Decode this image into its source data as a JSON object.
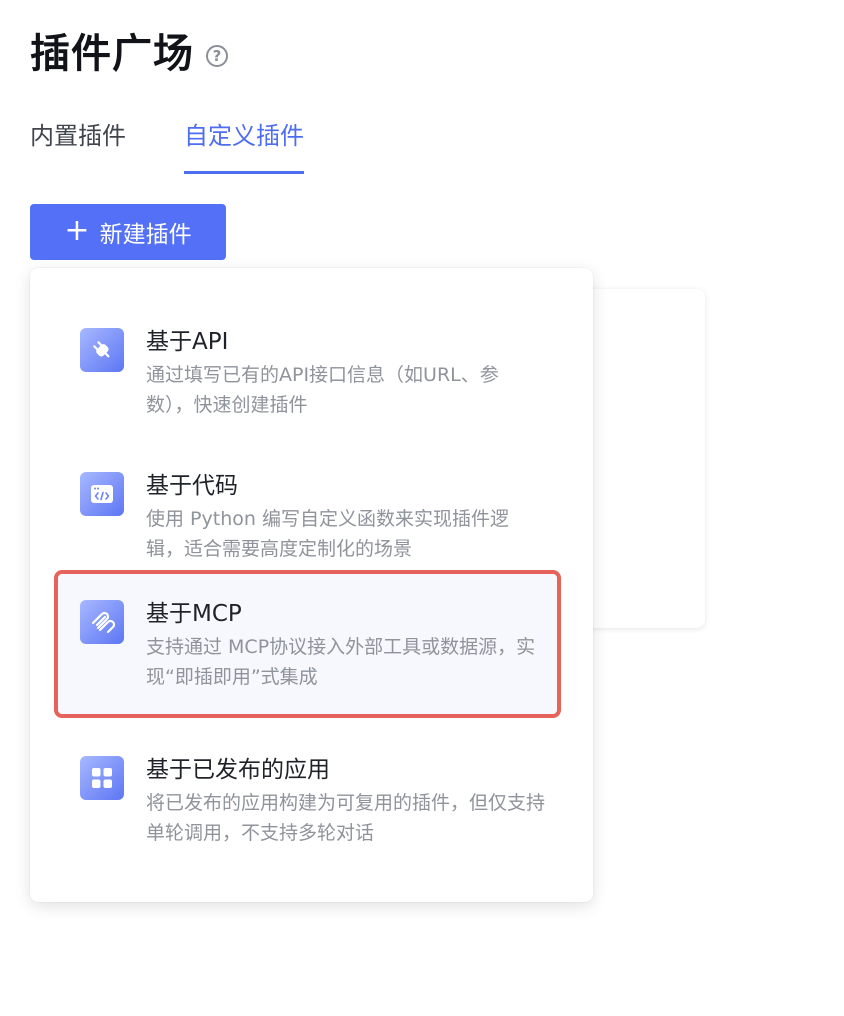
{
  "header": {
    "title": "插件广场",
    "help_icon": "?"
  },
  "tabs": [
    {
      "label": "内置插件",
      "active": false
    },
    {
      "label": "自定义插件",
      "active": true
    }
  ],
  "new_button": {
    "icon": "+",
    "label": "新建插件"
  },
  "menu": {
    "items": [
      {
        "title": "基于API",
        "desc": "通过填写已有的API接口信息（如URL、参数），快速创建插件",
        "icon": "plug-icon"
      },
      {
        "title": "基于代码",
        "desc": "使用 Python 编写自定义函数来实现插件逻辑，适合需要高度定制化的场景",
        "icon": "code-icon"
      },
      {
        "title": "基于MCP",
        "desc": "支持通过 MCP协议接入外部工具或数据源，实现“即插即用”式集成",
        "icon": "mcp-icon",
        "highlighted": true
      },
      {
        "title": "基于已发布的应用",
        "desc": "将已发布的应用构建为可复用的插件，但仅支持单轮调用，不支持多轮对话",
        "icon": "apps-grid-icon"
      }
    ]
  },
  "colors": {
    "accent": "#4e6ef2",
    "button": "#5470f6",
    "highlight_border": "#e5635a"
  }
}
